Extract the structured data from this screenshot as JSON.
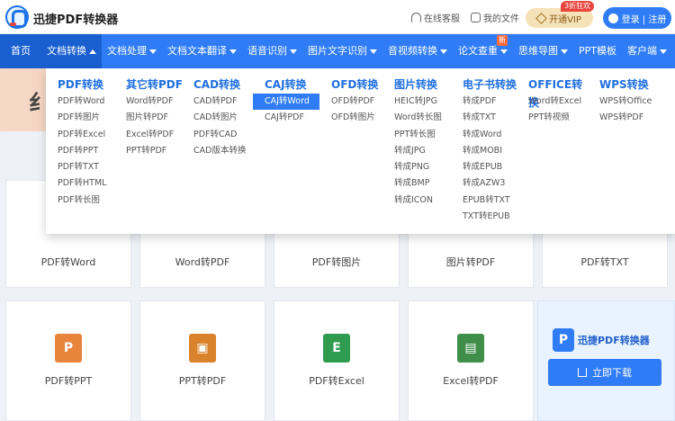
{
  "header": {
    "brand": "迅捷PDF转换器",
    "service": "在线客服",
    "my_files": "我的文件",
    "vip_label": "开通VIP",
    "vip_badge": "3折狂欢",
    "login": "登录 | 注册"
  },
  "nav": {
    "items": [
      {
        "label": "首页"
      },
      {
        "label": "文档转换"
      },
      {
        "label": "文档处理"
      },
      {
        "label": "文档文本翻译"
      },
      {
        "label": "语音识别"
      },
      {
        "label": "图片文字识别"
      },
      {
        "label": "音视频转换"
      },
      {
        "label": "论文查重",
        "badge": "新"
      },
      {
        "label": "思维导图"
      },
      {
        "label": "PPT模板"
      },
      {
        "label": "客户端"
      }
    ]
  },
  "banner": {
    "glyph": "纟"
  },
  "dropdown": {
    "columns": [
      {
        "title": "PDF转换",
        "items": [
          "PDF转Word",
          "PDF转图片",
          "PDF转Excel",
          "PDF转PPT",
          "PDF转TXT",
          "PDF转HTML",
          "PDF转长图"
        ]
      },
      {
        "title": "其它转PDF",
        "items": [
          "Word转PDF",
          "图片转PDF",
          "Excel转PDF",
          "PPT转PDF"
        ]
      },
      {
        "title": "CAD转换",
        "items": [
          "CAD转PDF",
          "CAD转图片",
          "PDF转CAD",
          "CAD版本转换"
        ]
      },
      {
        "title": "CAJ转换",
        "items": [
          "CAJ转Word",
          "CAJ转PDF"
        ]
      },
      {
        "title": "OFD转换",
        "items": [
          "OFD转PDF",
          "OFD转图片"
        ]
      },
      {
        "title": "图片转换",
        "items": [
          "HEIC转JPG",
          "Word转长图",
          "PPT转长图",
          "转成JPG",
          "转成PNG",
          "转成BMP",
          "转成ICON"
        ]
      },
      {
        "title": "电子书转换",
        "items": [
          "转成PDF",
          "转成TXT",
          "转成Word",
          "转成MOBI",
          "转成EPUB",
          "转成AZW3",
          "EPUB转TXT",
          "TXT转EPUB"
        ]
      },
      {
        "title": "OFFICE转换",
        "items": [
          "Word转Excel",
          "PPT转视频"
        ]
      },
      {
        "title": "WPS转换",
        "items": [
          "WPS转Office",
          "WPS转PDF"
        ]
      }
    ]
  },
  "tools": {
    "row1": [
      "PDF转Word",
      "Word转PDF",
      "PDF转图片",
      "图片转PDF",
      "PDF转TXT"
    ],
    "row2": [
      {
        "label": "PDF转PPT",
        "icon": "P",
        "color": "#e8843b"
      },
      {
        "label": "PPT转PDF",
        "icon": "▣",
        "color": "#d9822b"
      },
      {
        "label": "PDF转Excel",
        "icon": "E",
        "color": "#2e9b4f"
      },
      {
        "label": "Excel转PDF",
        "icon": "▤",
        "color": "#3f8f4a"
      }
    ]
  },
  "promo": {
    "title": "迅捷PDF转换器",
    "download": "立即下载"
  },
  "colors": {
    "primary": "#2f7cf6",
    "active_nav": "#1a5fd0",
    "dropdown_title": "#1f6fe0"
  }
}
